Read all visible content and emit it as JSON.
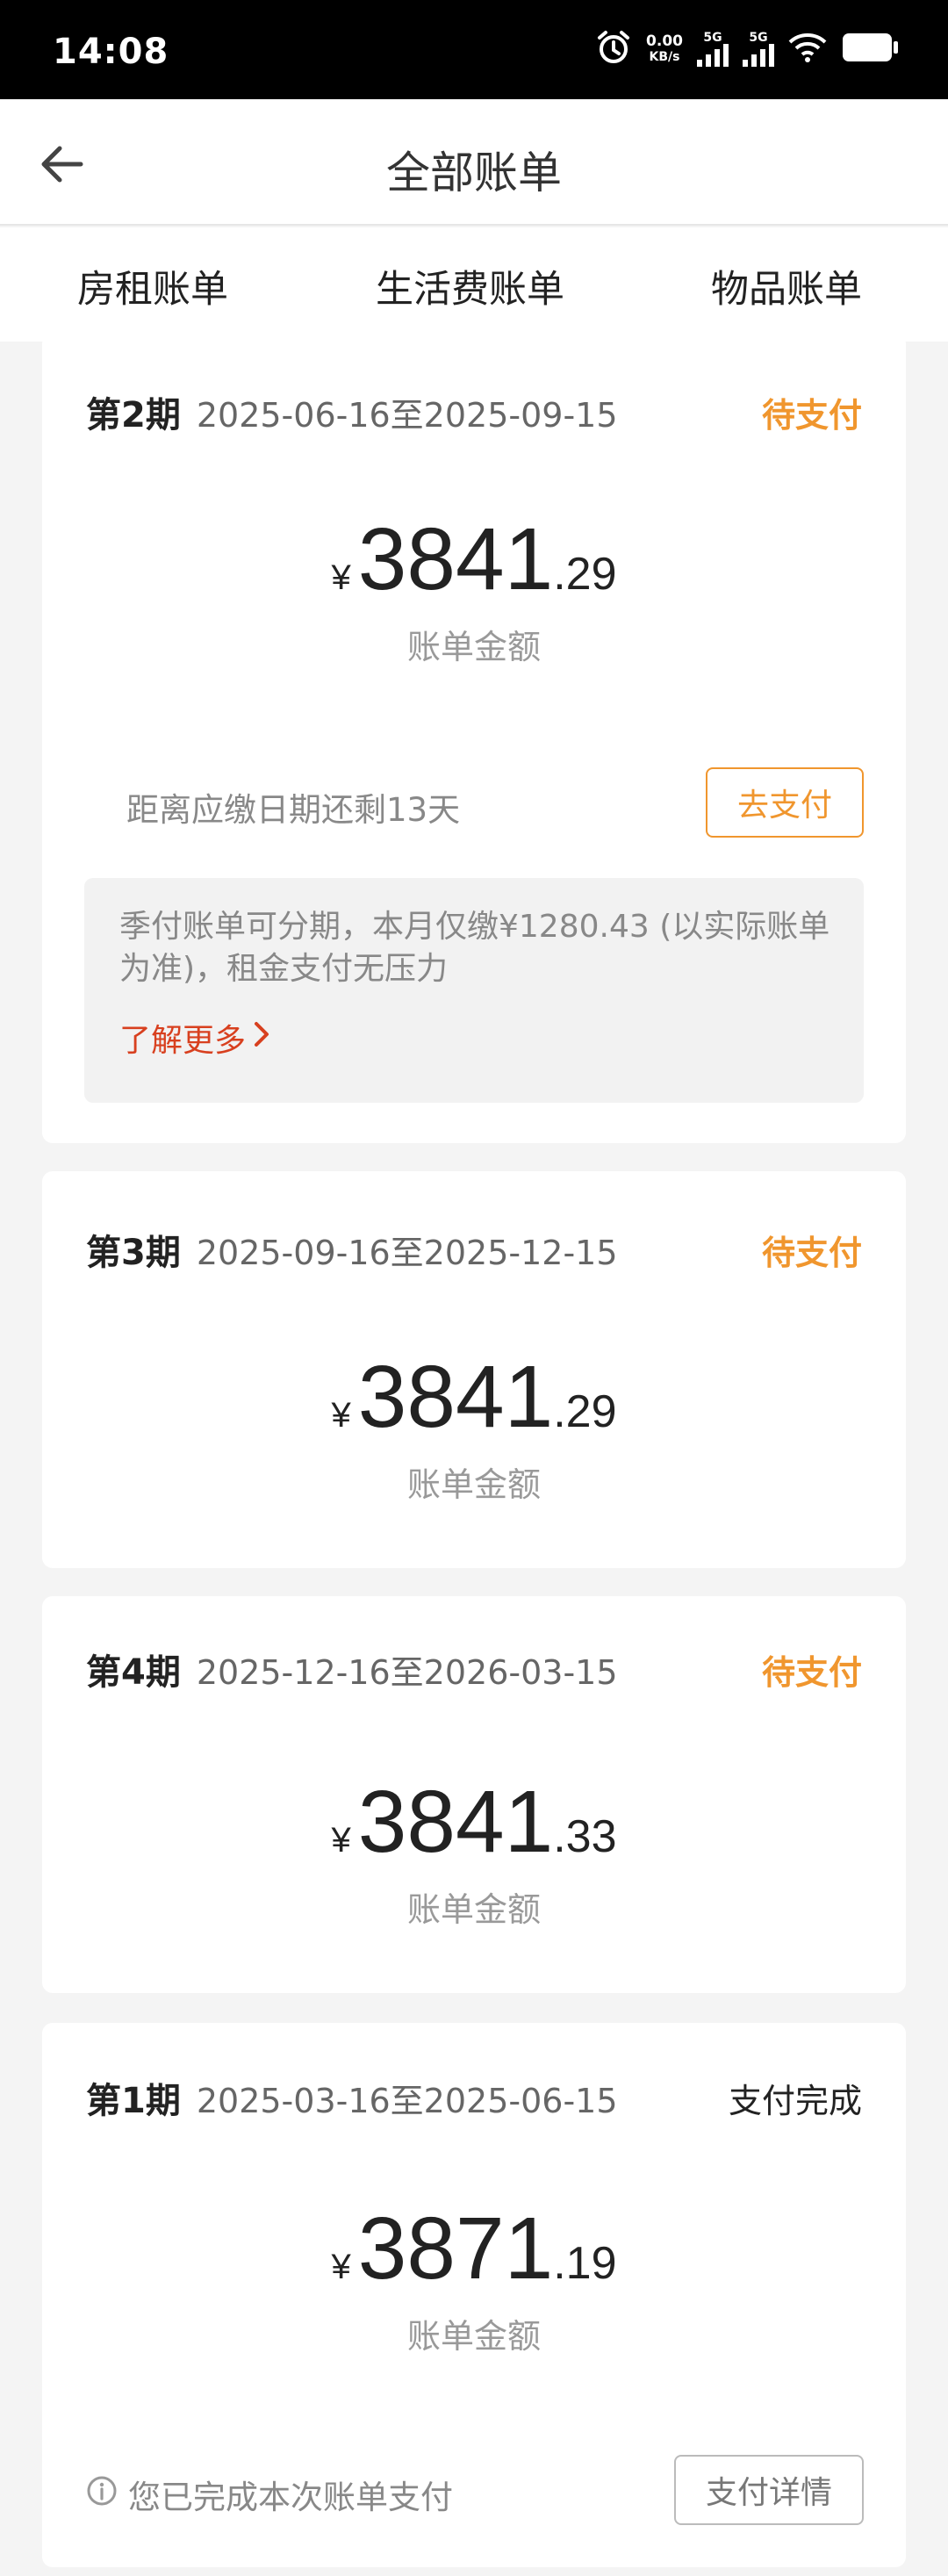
{
  "status_bar": {
    "time": "14:08",
    "net_speed_value": "0.00",
    "net_speed_unit": "KB/s",
    "sim1": "5G",
    "sim2": "5G",
    "icons": [
      "alarm-icon",
      "signal-icon",
      "signal-icon",
      "wifi-icon",
      "battery-icon"
    ]
  },
  "header": {
    "title": "全部账单",
    "back_icon": "arrow-left-icon"
  },
  "tabs": [
    {
      "label": "房租账单",
      "active": true
    },
    {
      "label": "生活费账单",
      "active": false
    },
    {
      "label": "物品账单",
      "active": false
    }
  ],
  "colors": {
    "accent": "#d8401f",
    "pending": "#f0962e",
    "background": "#f4f4f4"
  },
  "bills": [
    {
      "period": "第2期",
      "range": "2025-06-16至2025-09-15",
      "status": "待支付",
      "currency": "¥",
      "amount_int": "3841",
      "amount_dec": ".29",
      "amount_label": "账单金额",
      "countdown": "距离应缴日期还剩13天",
      "pay_button": "去支付",
      "installment_text": "季付账单可分期，本月仅缴¥1280.43 (以实际账单为准)，租金支付无压力",
      "learn_more": "了解更多"
    },
    {
      "period": "第3期",
      "range": "2025-09-16至2025-12-15",
      "status": "待支付",
      "currency": "¥",
      "amount_int": "3841",
      "amount_dec": ".29",
      "amount_label": "账单金额"
    },
    {
      "period": "第4期",
      "range": "2025-12-16至2026-03-15",
      "status": "待支付",
      "currency": "¥",
      "amount_int": "3841",
      "amount_dec": ".33",
      "amount_label": "账单金额"
    },
    {
      "period": "第1期",
      "range": "2025-03-16至2025-06-15",
      "status": "支付完成",
      "currency": "¥",
      "amount_int": "3871",
      "amount_dec": ".19",
      "amount_label": "账单金额",
      "done_note": "您已完成本次账单支付",
      "detail_button": "支付详情"
    }
  ]
}
